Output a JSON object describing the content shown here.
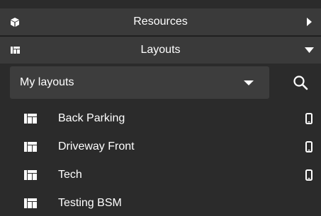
{
  "sections": {
    "resources": {
      "label": "Resources",
      "icon": "cube-icon",
      "arrow": "chevron-right-icon"
    },
    "layouts": {
      "label": "Layouts",
      "icon": "layout-icon",
      "arrow": "chevron-down-icon"
    }
  },
  "filter": {
    "selected": "My layouts",
    "search_icon": "search-icon"
  },
  "layouts": [
    {
      "label": "Back Parking",
      "mobile": true
    },
    {
      "label": "Driveway Front",
      "mobile": true
    },
    {
      "label": "Tech",
      "mobile": true
    },
    {
      "label": "Testing BSM",
      "mobile": false
    }
  ],
  "colors": {
    "background": "#2b2b2b",
    "header": "#3a3a3a",
    "dropdown": "#3d3d3d",
    "text": "#ffffff"
  }
}
